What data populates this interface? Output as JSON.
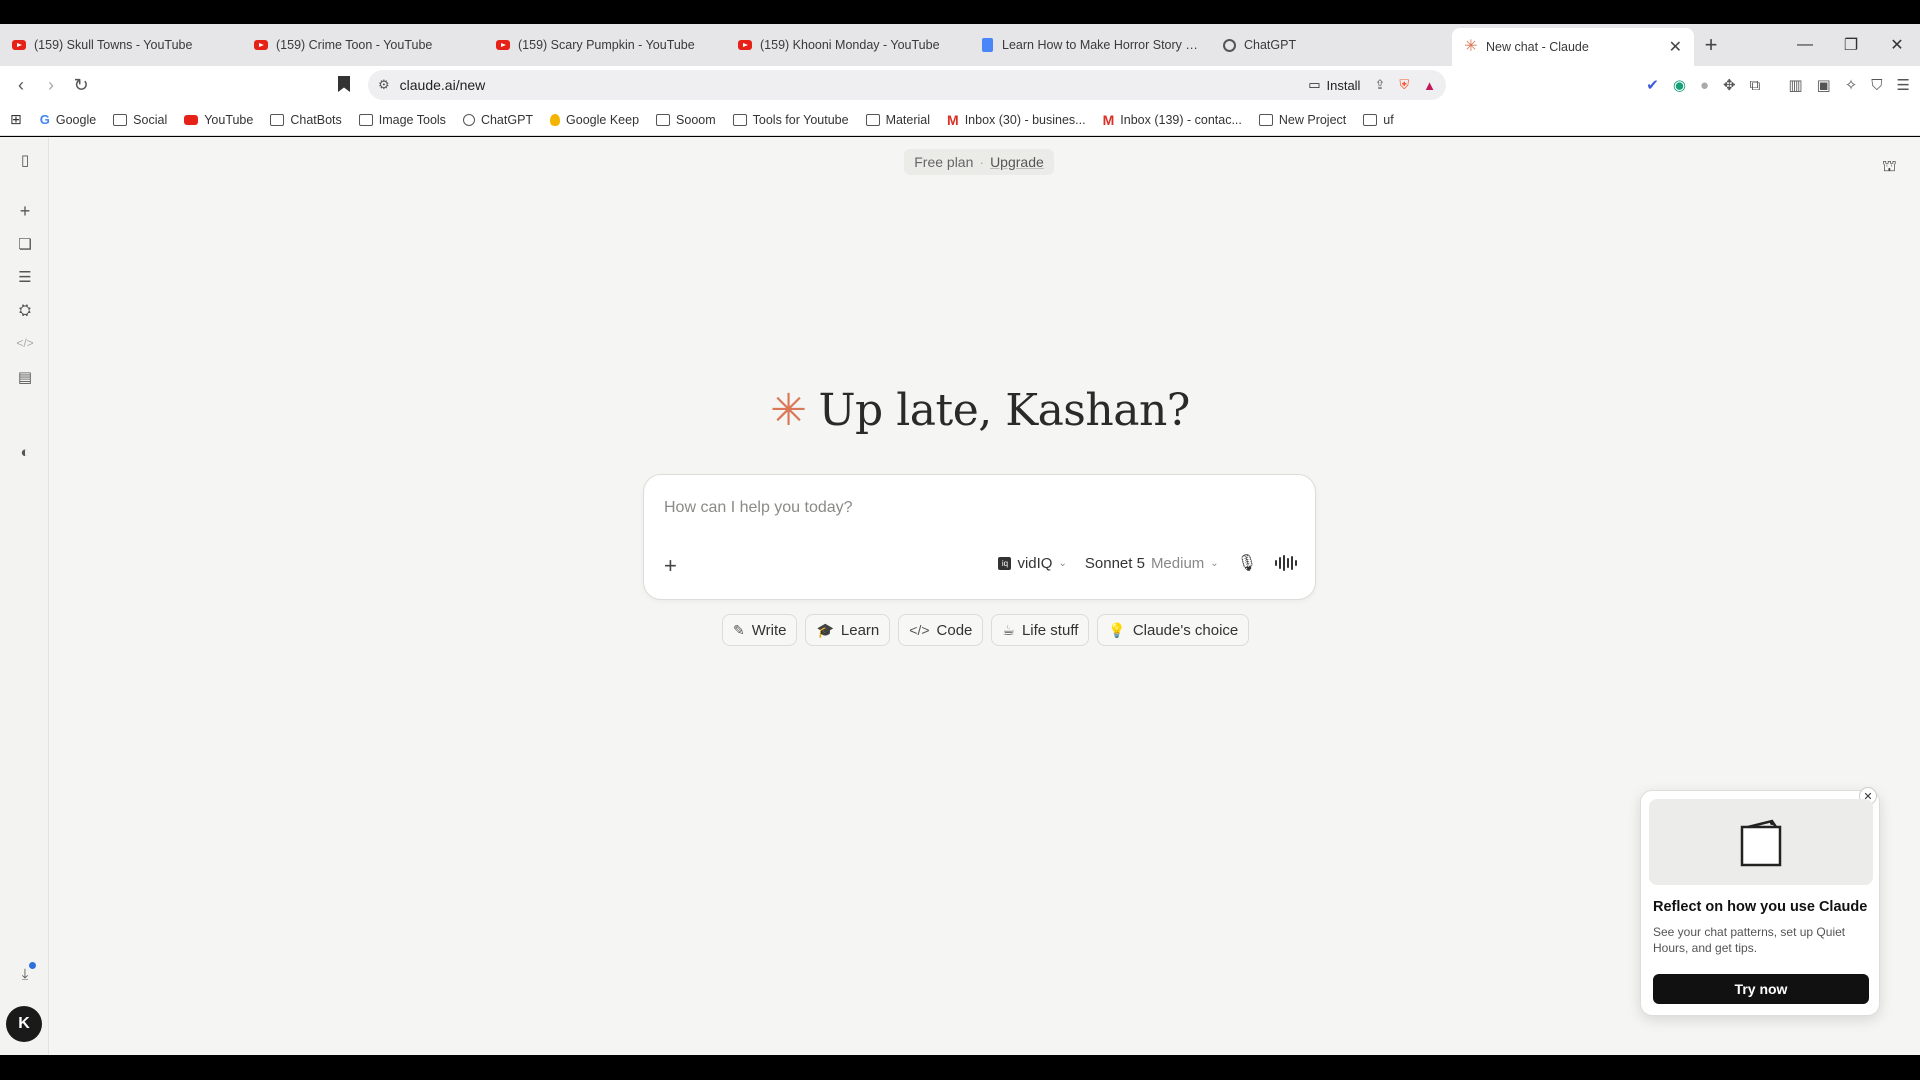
{
  "tabs": [
    {
      "title": "(159) Skull Towns - YouTube",
      "icon": "youtube-icon"
    },
    {
      "title": "(159) Crime Toon - YouTube",
      "icon": "youtube-icon"
    },
    {
      "title": "(159) Scary Pumpkin - YouTube",
      "icon": "youtube-icon"
    },
    {
      "title": "(159) Khooni Monday - YouTube",
      "icon": "youtube-icon"
    },
    {
      "title": "Learn How to Make Horror Story Vid",
      "icon": "docs-icon"
    },
    {
      "title": "ChatGPT",
      "icon": "chatgpt-icon"
    },
    {
      "title": "New chat - Claude",
      "icon": "claude-icon"
    }
  ],
  "address": {
    "url": "claude.ai/new",
    "install_label": "Install"
  },
  "bookmarks": [
    {
      "label": "Google",
      "icon": "google-icon"
    },
    {
      "label": "Social",
      "icon": "folder-icon"
    },
    {
      "label": "YouTube",
      "icon": "youtube-icon"
    },
    {
      "label": "ChatBots",
      "icon": "folder-icon"
    },
    {
      "label": "Image Tools",
      "icon": "folder-icon"
    },
    {
      "label": "ChatGPT",
      "icon": "chatgpt-icon"
    },
    {
      "label": "Google Keep",
      "icon": "keep-icon"
    },
    {
      "label": "Sooom",
      "icon": "folder-icon"
    },
    {
      "label": "Tools for Youtube",
      "icon": "folder-icon"
    },
    {
      "label": "Material",
      "icon": "folder-icon"
    },
    {
      "label": "Inbox (30) - busines...",
      "icon": "gmail-icon"
    },
    {
      "label": "Inbox (139) - contac...",
      "icon": "gmail-icon"
    },
    {
      "label": "New Project",
      "icon": "folder-icon"
    },
    {
      "label": "uf",
      "icon": "folder-icon"
    }
  ],
  "plan": {
    "free_label": "Free plan",
    "upgrade_label": "Upgrade"
  },
  "greeting": "Up late, Kashan?",
  "composer": {
    "placeholder": "How can I help you today?",
    "tool_label": "vidIQ",
    "model_label": "Sonnet 5",
    "effort_label": "Medium"
  },
  "chips": [
    {
      "label": "Write",
      "icon": "pencil-icon"
    },
    {
      "label": "Learn",
      "icon": "graduation-cap-icon"
    },
    {
      "label": "Code",
      "icon": "code-icon"
    },
    {
      "label": "Life stuff",
      "icon": "coffee-icon"
    },
    {
      "label": "Claude's choice",
      "icon": "lightbulb-icon"
    }
  ],
  "user": {
    "initial": "K"
  },
  "popup": {
    "title": "Reflect on how you use Claude",
    "description": "See your chat patterns, set up Quiet Hours, and get tips.",
    "button_label": "Try now"
  },
  "colors": {
    "accent": "#d97757",
    "background": "#f5f5f3"
  }
}
